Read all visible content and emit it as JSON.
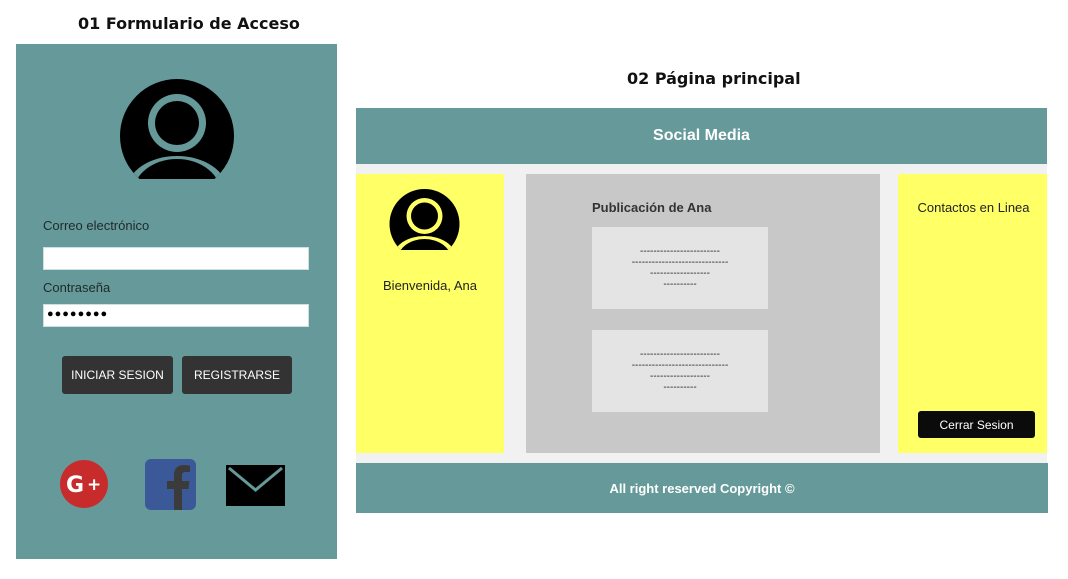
{
  "login_screen": {
    "title": "01 Formulario de Acceso",
    "email_label": "Correo electrónico",
    "email_value": "",
    "password_label": "Contraseña",
    "password_value": "●●●●●●●●",
    "login_button": "INICIAR SESION",
    "register_button": "REGISTRARSE",
    "social_icons": [
      "google-plus-icon",
      "facebook-icon",
      "mail-icon"
    ],
    "colors": {
      "panel": "#669999",
      "button": "#333333",
      "google": "#c72b2b",
      "facebook": "#3b5998"
    }
  },
  "main_screen": {
    "title": "02 Página principal",
    "header_title": "Social Media",
    "welcome_text": "Bienvenida, Ana",
    "publication_title": "Publicación de Ana",
    "posts": [
      {
        "lines": [
          "------------------------",
          "-----------------------------",
          "------------------",
          "----------"
        ]
      },
      {
        "lines": [
          "------------------------",
          "-----------------------------",
          "------------------",
          "----------"
        ]
      }
    ],
    "contacts_title": "Contactos en Linea",
    "logout_button": "Cerrar Sesion",
    "footer_text": "All right reserved Copyright ©",
    "colors": {
      "header": "#669999",
      "sidebar": "#ffff66",
      "center": "#c8c8c8",
      "post": "#e4e4e4"
    }
  }
}
